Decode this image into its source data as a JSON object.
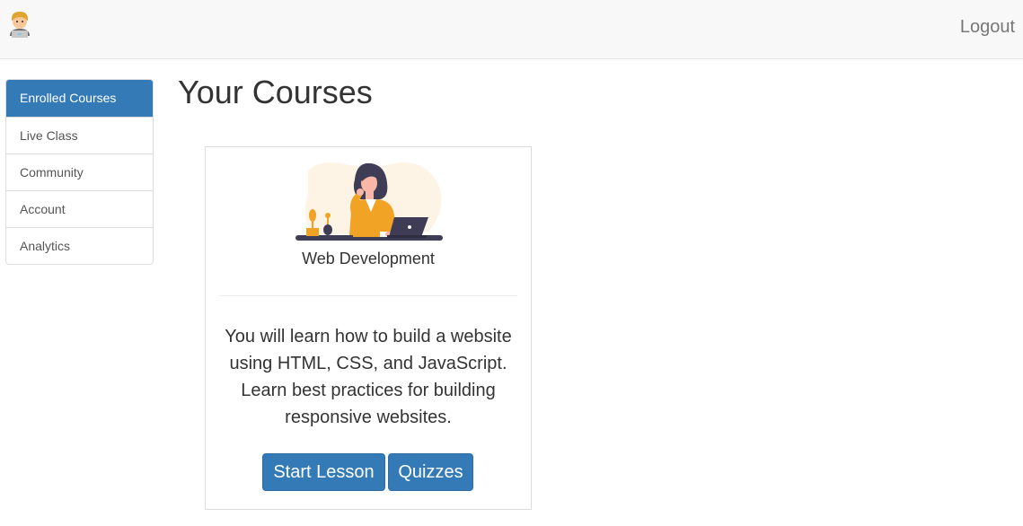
{
  "header": {
    "brand_icon": "man-technologist-emoji-icon",
    "logout_label": "Logout"
  },
  "sidebar": {
    "items": [
      {
        "label": "Enrolled Courses",
        "active": true
      },
      {
        "label": "Live Class",
        "active": false
      },
      {
        "label": "Community",
        "active": false
      },
      {
        "label": "Account",
        "active": false
      },
      {
        "label": "Analytics",
        "active": false
      }
    ]
  },
  "main": {
    "title": "Your Courses",
    "courses": [
      {
        "illustration": "woman-at-laptop-illustration",
        "name": "Web Development",
        "description": "You will learn how to build a website using HTML, CSS, and JavaScript. Learn best practices for building responsive websites.",
        "start_label": "Start Lesson",
        "quiz_label": "Quizzes"
      }
    ]
  },
  "colors": {
    "primary": "#337ab7",
    "navbar_bg": "#f8f8f8",
    "illustration_accent": "#f0a324",
    "illustration_dark": "#3f3d56"
  }
}
